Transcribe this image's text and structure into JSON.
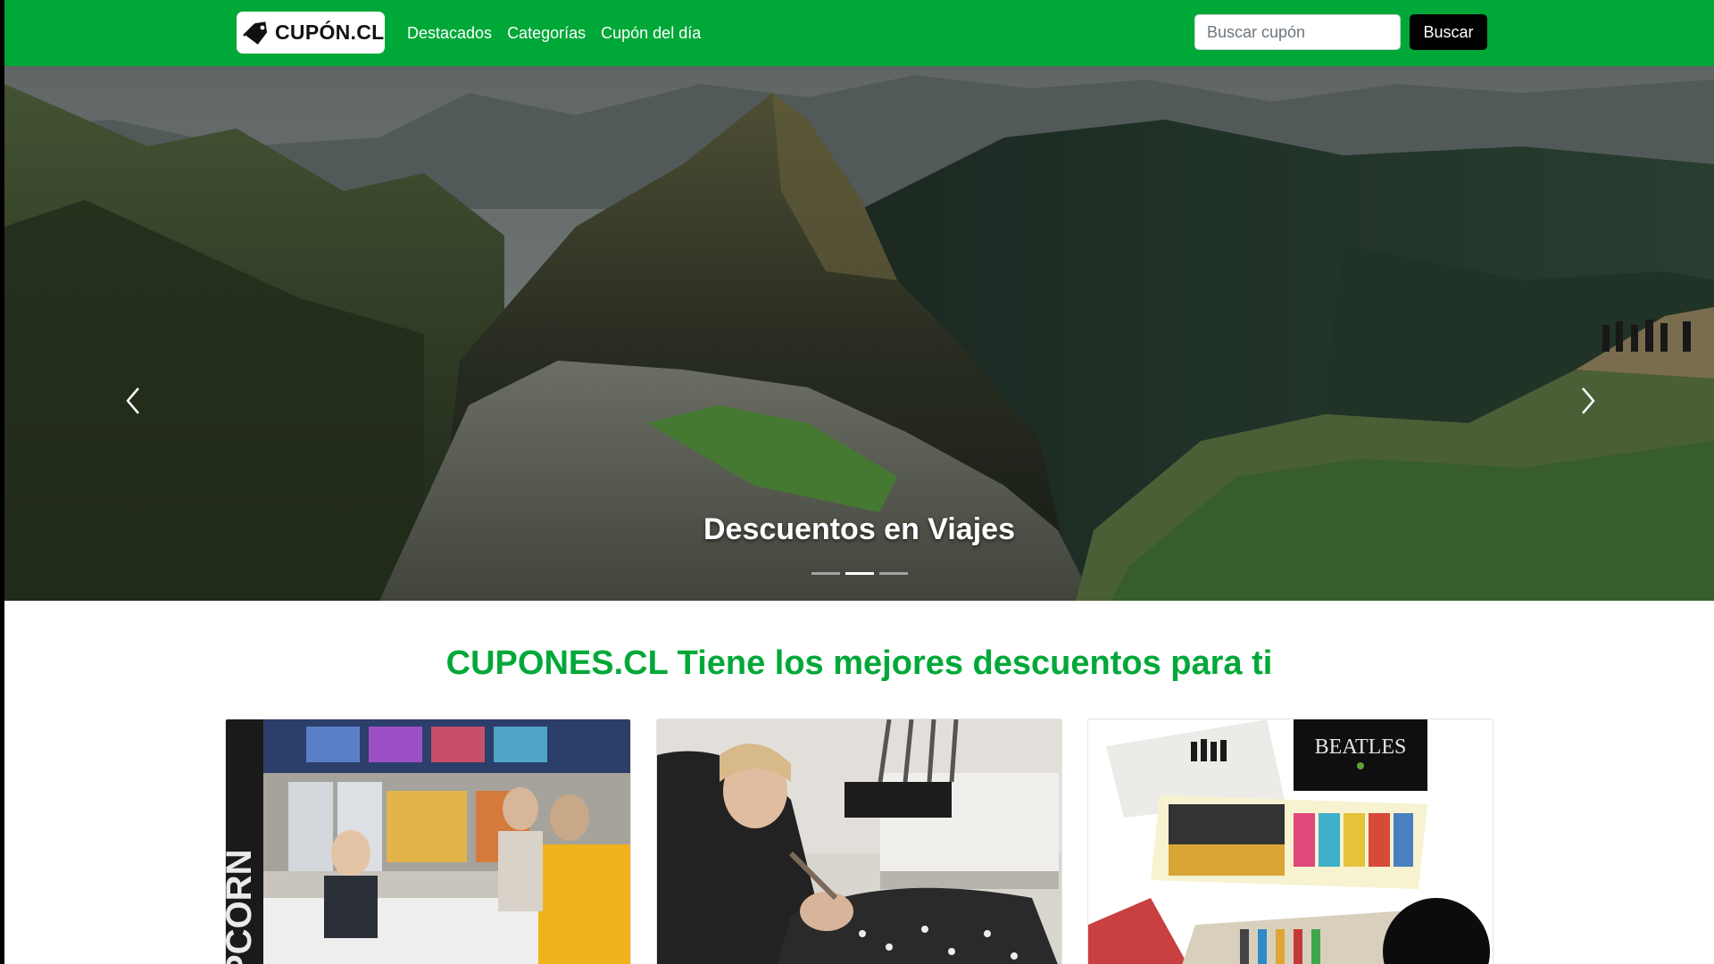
{
  "brand": {
    "logo_text": "CUPÓN.CL",
    "accent": "#00a838"
  },
  "nav": {
    "items": [
      {
        "label": "Destacados"
      },
      {
        "label": "Categorías"
      },
      {
        "label": "Cupón del día"
      }
    ]
  },
  "search": {
    "placeholder": "Buscar cupón",
    "value": "",
    "button_label": "Buscar"
  },
  "carousel": {
    "slide_caption": "Descuentos en Viajes",
    "slide_count": 3,
    "active_slide": 2,
    "prev_icon": "chevron-left-icon",
    "next_icon": "chevron-right-icon"
  },
  "headline": {
    "brand": "CUPONES.CL",
    "text": " Tiene los mejores descuentos para ti"
  },
  "cards": [
    {
      "name": "cinema-candy-bar"
    },
    {
      "name": "dentist"
    },
    {
      "name": "beatles-vinyl",
      "album_text": "BEATLES"
    }
  ]
}
